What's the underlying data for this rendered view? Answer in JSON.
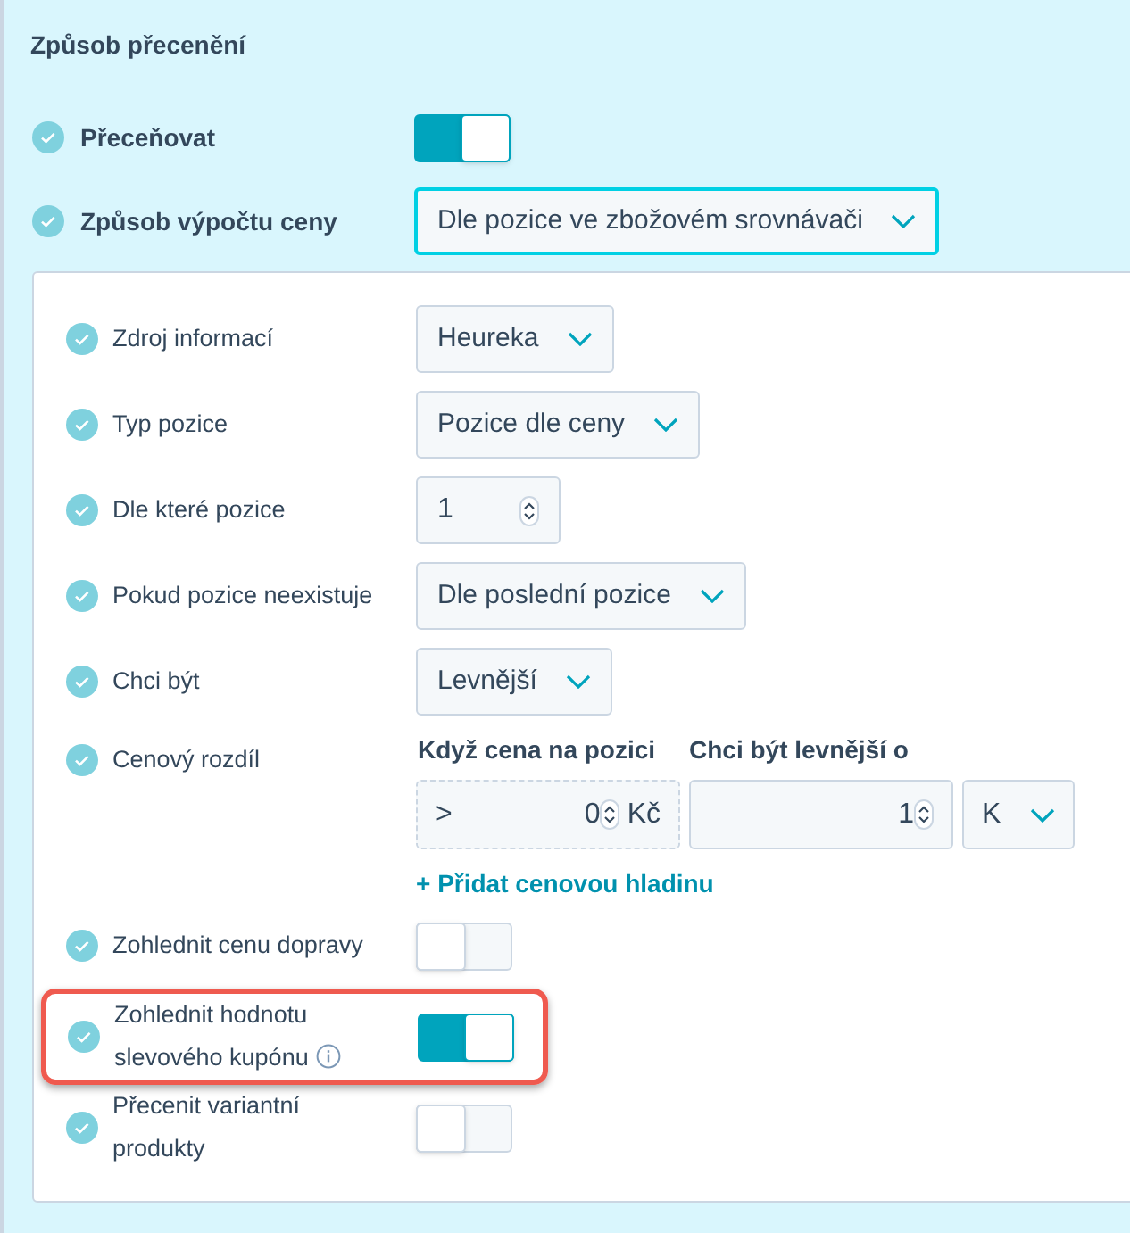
{
  "section_title": "Způsob přecenění",
  "top_rows": [
    {
      "kind": "toggle",
      "label": "Přeceňovat",
      "on": true
    },
    {
      "kind": "select",
      "label": "Způsob výpočtu ceny",
      "value": "Dle pozice ve zbožovém srovnávači",
      "focused": true
    }
  ],
  "panel_rows": [
    {
      "kind": "select",
      "label": "Zdroj informací",
      "value": "Heureka"
    },
    {
      "kind": "select",
      "label": "Typ pozice",
      "value": "Pozice dle ceny"
    },
    {
      "kind": "number",
      "label": "Dle které pozice",
      "value": "1"
    },
    {
      "kind": "select",
      "label": "Pokud pozice neexistuje",
      "value": "Dle poslední pozice"
    },
    {
      "kind": "select",
      "label": "Chci být",
      "value": "Levnější"
    },
    {
      "kind": "price_difference",
      "label": "Cenový rozdíl",
      "threshold_header": "Když cena na pozici",
      "difference_header": "Chci být levnější o",
      "operator": ">",
      "threshold": "0",
      "currency": "Kč",
      "difference": "1",
      "unit": "K",
      "add_link": "+ Přidat cenovou hladinu"
    },
    {
      "kind": "toggle",
      "label": "Zohlednit cenu dopravy",
      "on": false,
      "highlighted": false,
      "info": false
    },
    {
      "kind": "toggle",
      "label": "Zohlednit hodnotu slevového kupónu",
      "on": true,
      "highlighted": true,
      "info": true
    },
    {
      "kind": "toggle",
      "label": "Přecenit variantní produkty",
      "on": false,
      "highlighted": false,
      "info": false
    }
  ]
}
